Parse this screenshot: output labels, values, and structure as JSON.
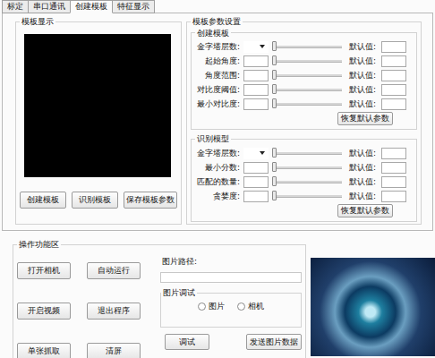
{
  "tabs": [
    {
      "label": "标定",
      "selected": false
    },
    {
      "label": "串口通讯",
      "selected": false
    },
    {
      "label": "创建模板",
      "selected": true
    },
    {
      "label": "特征显示",
      "selected": false
    }
  ],
  "template_display": {
    "title": "模板显示",
    "buttons": [
      "创建模板",
      "识别模板",
      "保存模板参数"
    ]
  },
  "params": {
    "title": "模板参数设置",
    "groups": [
      {
        "title": "创建模板",
        "reset_button": "恢复默认参数",
        "rows": [
          {
            "label": "金字塔层数:",
            "kind": "dropdown",
            "value": "",
            "level": 0,
            "default_label": "默认值:",
            "default_value": ""
          },
          {
            "label": "起始角度:",
            "kind": "input",
            "value": "",
            "level": 0,
            "default_label": "默认值:",
            "default_value": ""
          },
          {
            "label": "角度范围:",
            "kind": "input",
            "value": "",
            "level": 0,
            "default_label": "默认值:",
            "default_value": ""
          },
          {
            "label": "对比度阈值:",
            "kind": "input",
            "value": "",
            "level": 0,
            "default_label": "默认值:",
            "default_value": ""
          },
          {
            "label": "最小对比度:",
            "kind": "input",
            "value": "",
            "level": 0,
            "default_label": "默认值:",
            "default_value": ""
          }
        ]
      },
      {
        "title": "识别模型",
        "reset_button": "恢复默认参数",
        "rows": [
          {
            "label": "金字塔层数:",
            "kind": "dropdown",
            "value": "",
            "level": 0,
            "default_label": "默认值:",
            "default_value": ""
          },
          {
            "label": "最小分数:",
            "kind": "input",
            "value": "",
            "level": 0,
            "default_label": "默认值:",
            "default_value": ""
          },
          {
            "label": "匹配的数量:",
            "kind": "input",
            "value": "",
            "level": 0,
            "default_label": "默认值:",
            "default_value": ""
          },
          {
            "label": "贪婪度:",
            "kind": "input",
            "value": "",
            "level": 0,
            "default_label": "默认值:",
            "default_value": ""
          }
        ]
      }
    ]
  },
  "operations": {
    "title": "操作功能区",
    "buttons": [
      "打开相机",
      "自动运行",
      "开启视频",
      "退出程序",
      "单张抓取",
      "清屏"
    ],
    "path_label": "图片路径:",
    "path_value": "",
    "debug": {
      "title": "图片调试",
      "radios": [
        {
          "label": "图片",
          "selected": false
        },
        {
          "label": "相机",
          "selected": false
        }
      ]
    },
    "action_buttons": [
      "调试",
      "发送图片数据"
    ]
  }
}
